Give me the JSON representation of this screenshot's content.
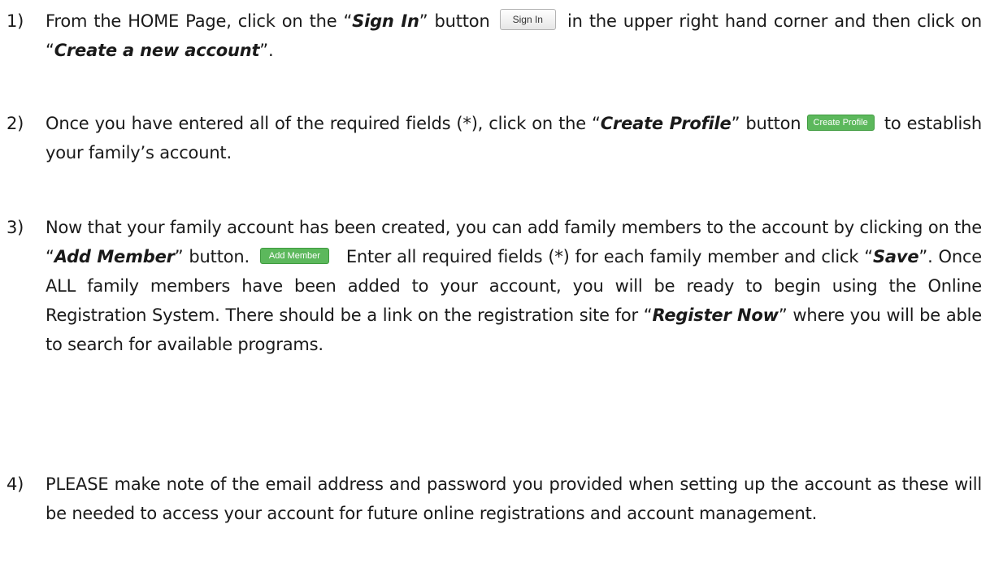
{
  "steps": [
    {
      "number": "1)",
      "parts": {
        "t1": "From the HOME Page, click on the “",
        "b1": "Sign In",
        "t2": "” button ",
        "button": "Sign In",
        "t3": " in the upper right hand corner and then click on “",
        "b2": "Create a new account",
        "t4": "”."
      }
    },
    {
      "number": "2)",
      "parts": {
        "t1": "Once you have entered all of the required fields (*), click on the “",
        "b1": "Create Profile",
        "t2": "” button ",
        "button": "Create Profile",
        "t3": " to establish your family’s account."
      }
    },
    {
      "number": "3)",
      "parts": {
        "t1": "Now that your family account has been created, you can add family members to the account by clicking on the “",
        "b1": "Add Member",
        "t2": "” button. ",
        "button": "Add Member",
        "t3": " Enter all required fields (*) for each family member and click “",
        "b2": "Save",
        "t4": "”.  Once ALL family members have been added to your account, you will be ready to begin using the Online Registration System.  There should be a link on the registration site for “",
        "b3": "Register Now",
        "t5": "” where you will be able to search for available programs."
      }
    },
    {
      "number": "4)",
      "parts": {
        "t1": "PLEASE make note of the email address and password you provided when setting up the account as these will be needed to access your account for future online registrations and account management."
      }
    }
  ],
  "colors": {
    "text": "#1a1a1a",
    "green_button": "#5cb85c",
    "gray_button_border": "#b3b3b3"
  }
}
